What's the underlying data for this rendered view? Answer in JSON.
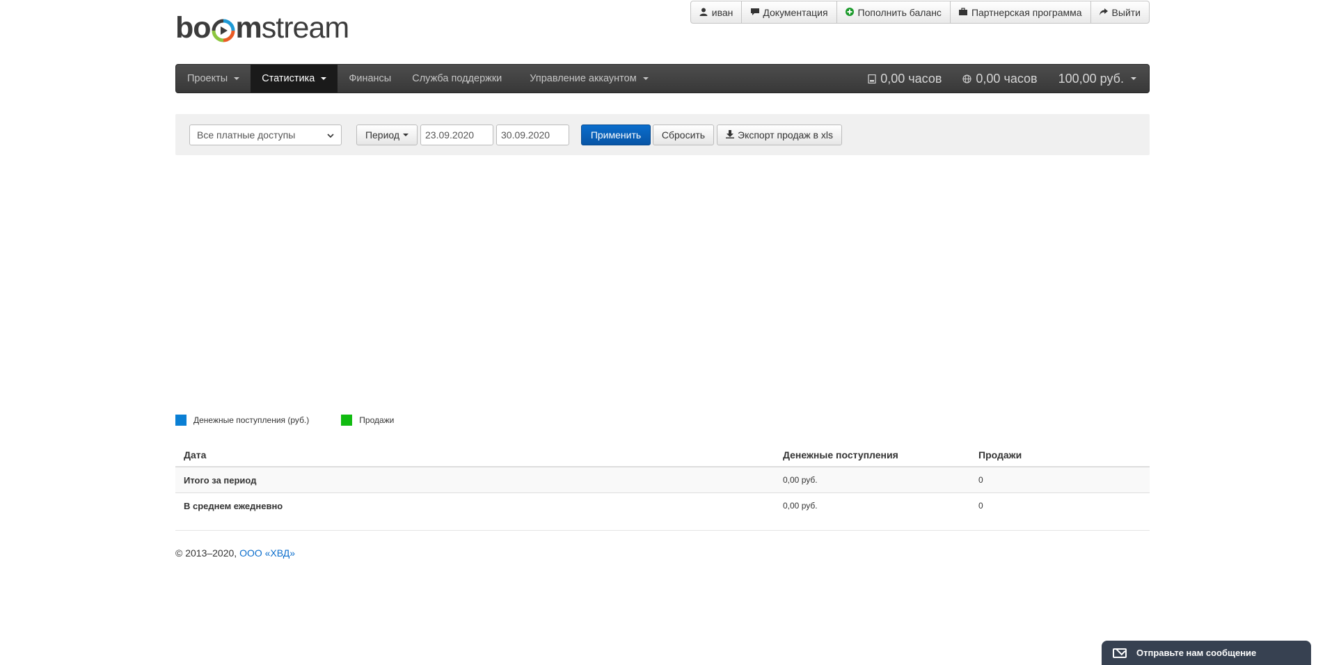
{
  "logo": {
    "part1": "bo",
    "part2": "m",
    "part3": "stream"
  },
  "topbar": {
    "user": "иван",
    "docs": "Документация",
    "topup": "Пополнить баланс",
    "partner": "Партнерская программа",
    "logout": "Выйти"
  },
  "nav": {
    "projects": "Проекты",
    "stats": "Статистика",
    "finance": "Финансы",
    "support": "Служба поддержки",
    "account": "Управление аккаунтом",
    "hours_record": "0,00 часов",
    "hours_live": "0,00 часов",
    "balance": "100,00 руб."
  },
  "filters": {
    "access_select": "Все платные доступы",
    "period_button": "Период",
    "date_from": "23.09.2020",
    "date_to": "30.09.2020",
    "apply": "Применить",
    "reset": "Сбросить",
    "export": "Экспорт продаж в xls"
  },
  "legend": {
    "income": "Денежные поступления (руб.)",
    "sales": "Продажи",
    "income_color": "#0a7fd4",
    "sales_color": "#11bb11"
  },
  "table": {
    "headers": {
      "date": "Дата",
      "income": "Денежные поступления",
      "sales": "Продажи"
    },
    "rows": [
      {
        "label": "Итого за период",
        "income": "0,00 руб.",
        "sales": "0"
      },
      {
        "label": "В среднем ежедневно",
        "income": "0,00 руб.",
        "sales": "0"
      }
    ]
  },
  "footer": {
    "copyright": "© 2013–2020,",
    "company": "ООО «ХВД»"
  },
  "chat": {
    "label": "Отправьте нам сообщение"
  }
}
